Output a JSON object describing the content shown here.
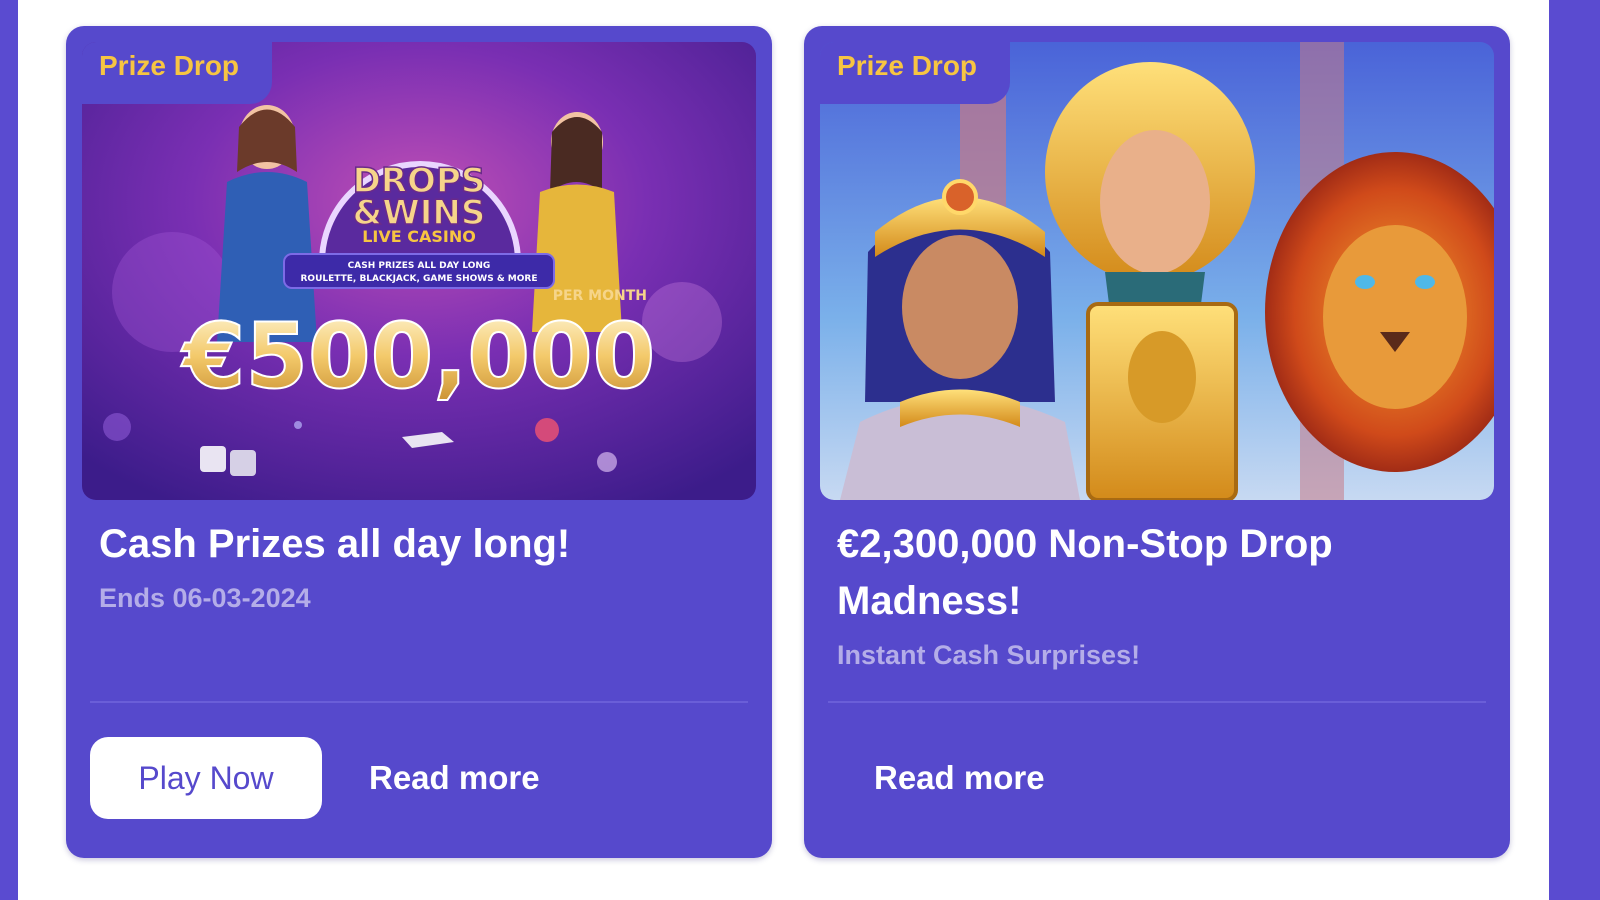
{
  "colors": {
    "page_background": "#5a4bd0",
    "card_background": "#5649cc",
    "tag_text": "#f7c542",
    "button_text": "#5649cc"
  },
  "cards": [
    {
      "tag": "Prize Drop",
      "image": {
        "logo_line1": "DROPS",
        "logo_line2": "&WINS",
        "logo_line3": "LIVE CASINO",
        "banner_line1": "CASH PRIZES ALL DAY LONG",
        "banner_line2": "ROULETTE, BLACKJACK, GAME SHOWS & MORE",
        "per_month": "PER MONTH",
        "amount": "€500,000"
      },
      "title": "Cash Prizes all day long!",
      "subtitle": "Ends 06-03-2024",
      "play_label": "Play Now",
      "read_more_label": "Read more"
    },
    {
      "tag": "Prize Drop",
      "title": "€2,300,000 Non-Stop Drop Madness!",
      "subtitle": "Instant Cash Surprises!",
      "read_more_label": "Read more"
    }
  ]
}
